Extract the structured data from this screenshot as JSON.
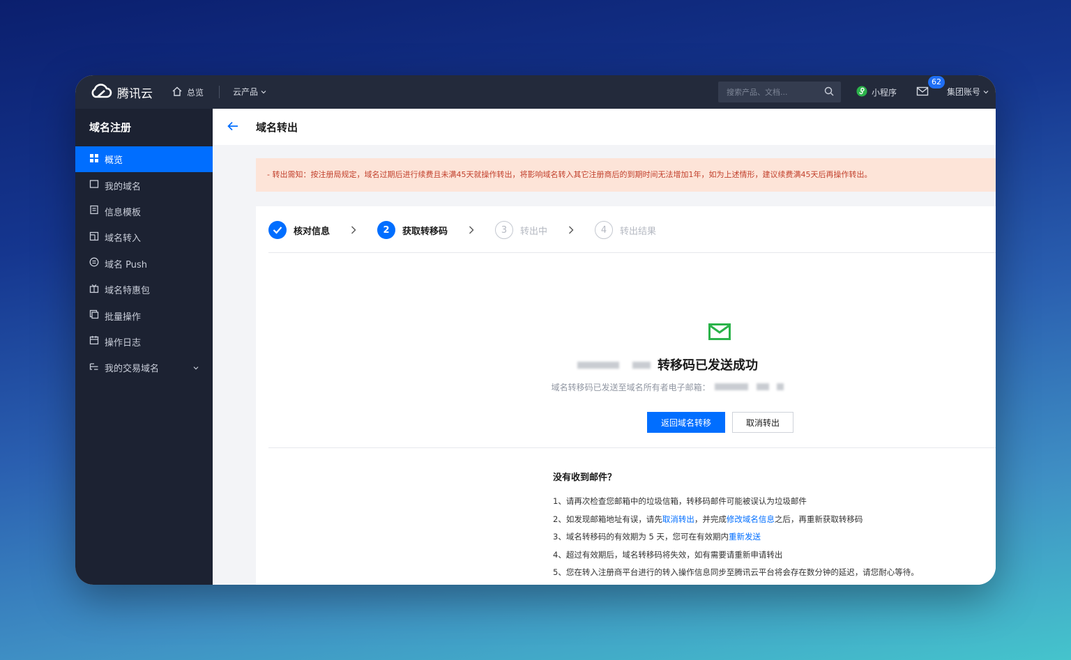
{
  "topbar": {
    "brand": "腾讯云",
    "home_label": "总览",
    "products_label": "云产品",
    "search_placeholder": "搜索产品、文档...",
    "mini_program_label": "小程序",
    "mail_badge": "62",
    "account_label": "集团账号"
  },
  "sidebar": {
    "title": "域名注册",
    "items": [
      {
        "label": "概览",
        "icon": "grid-icon"
      },
      {
        "label": "我的域名",
        "icon": "square-icon"
      },
      {
        "label": "信息模板",
        "icon": "document-icon"
      },
      {
        "label": "域名转入",
        "icon": "transfer-in-icon"
      },
      {
        "label": "域名 Push",
        "icon": "push-icon"
      },
      {
        "label": "域名特惠包",
        "icon": "gift-icon"
      },
      {
        "label": "批量操作",
        "icon": "copy-icon"
      },
      {
        "label": "操作日志",
        "icon": "calendar-icon"
      },
      {
        "label": "我的交易域名",
        "icon": "trade-icon"
      }
    ]
  },
  "header": {
    "title": "域名转出"
  },
  "notice": "- 转出需知：按注册局规定，域名过期后进行续费且未满45天就操作转出，将影响域名转入其它注册商后的到期时间无法增加1年，如为上述情形，建议续费满45天后再操作转出。",
  "steps": [
    {
      "number": "1",
      "label": "核对信息",
      "state": "done"
    },
    {
      "number": "2",
      "label": "获取转移码",
      "state": "current"
    },
    {
      "number": "3",
      "label": "转出中",
      "state": "todo"
    },
    {
      "number": "4",
      "label": "转出结果",
      "state": "todo"
    }
  ],
  "result": {
    "title": "转移码已发送成功",
    "desc": "域名转移码已发送至域名所有者电子邮箱：",
    "primary_button": "返回域名转移",
    "secondary_button": "取消转出"
  },
  "help": {
    "title": "没有收到邮件？",
    "line1": "1、请再次检查您邮箱中的垃圾信箱，转移码邮件可能被误认为垃圾邮件",
    "line2_a": "2、如发现邮箱地址有误，请先",
    "line2_link1": "取消转出",
    "line2_b": "，并完成",
    "line2_link2": "修改域名信息",
    "line2_c": "之后，再重新获取转移码",
    "line3_a": "3、域名转移码的有效期为 5 天，您可在有效期内",
    "line3_link": "重新发送",
    "line4": "4、超过有效期后，域名转移码将失效，如有需要请重新申请转出",
    "line5": "5、您在转入注册商平台进行的转入操作信息同步至腾讯云平台将会存在数分钟的延迟，请您耐心等待。"
  },
  "colors": {
    "primary": "#006eff",
    "topbar_bg": "#232a3b",
    "sidebar_bg": "#1c2232",
    "notice_bg": "#fde4d8",
    "notice_text": "#c2412d",
    "success_green": "#2bb34a"
  }
}
